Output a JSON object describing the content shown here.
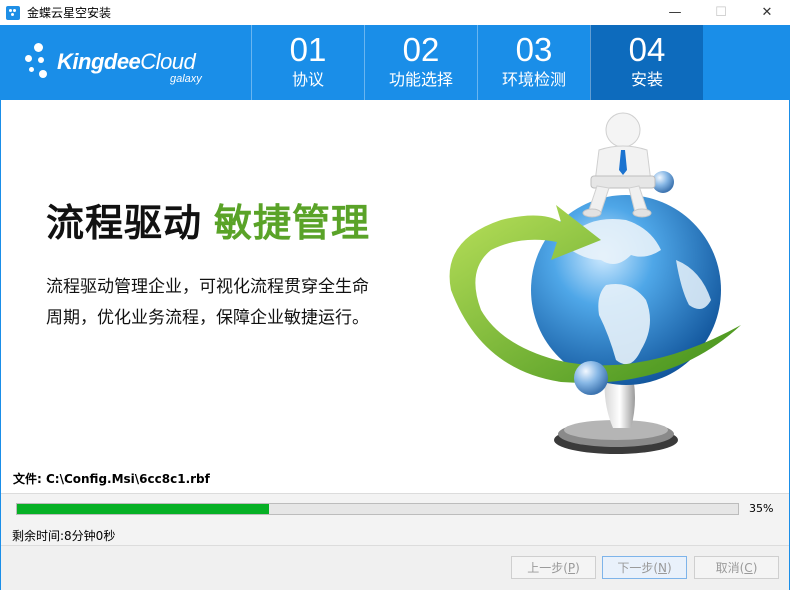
{
  "window": {
    "title": "金蝶云星空安装",
    "minimize": "—",
    "maximize": "☐",
    "close": "✕"
  },
  "logo": {
    "brand_bold": "Kingdee",
    "brand_light": "Cloud",
    "sub": "galaxy"
  },
  "steps": [
    {
      "num": "01",
      "label": "协议"
    },
    {
      "num": "02",
      "label": "功能选择"
    },
    {
      "num": "03",
      "label": "环境检测"
    },
    {
      "num": "04",
      "label": "安装"
    }
  ],
  "active_step": "04",
  "content": {
    "headline_black": "流程驱动",
    "headline_green": "敏捷管理",
    "desc_line1": "流程驱动管理企业，可视化流程贯穿全生命",
    "desc_line2": "周期，优化业务流程，保障企业敏捷运行。"
  },
  "status": {
    "file_label": "文件: C:\\Config.Msi\\6cc8c1.rbf",
    "progress": 0.35,
    "progress_text": "35%",
    "remaining": "剩余时间:8分钟0秒"
  },
  "buttons": {
    "prev_text": "上一步(",
    "prev_key": "P",
    "prev_end": ")",
    "next_text": "下一步(",
    "next_key": "N",
    "next_end": ")",
    "cancel_text": "取消(",
    "cancel_key": "C",
    "cancel_end": ")"
  },
  "colors": {
    "header_blue": "#1a8ee8",
    "active_step": "#0d6bbd",
    "accent_green": "#5aa328",
    "progress_green": "#06b025"
  }
}
